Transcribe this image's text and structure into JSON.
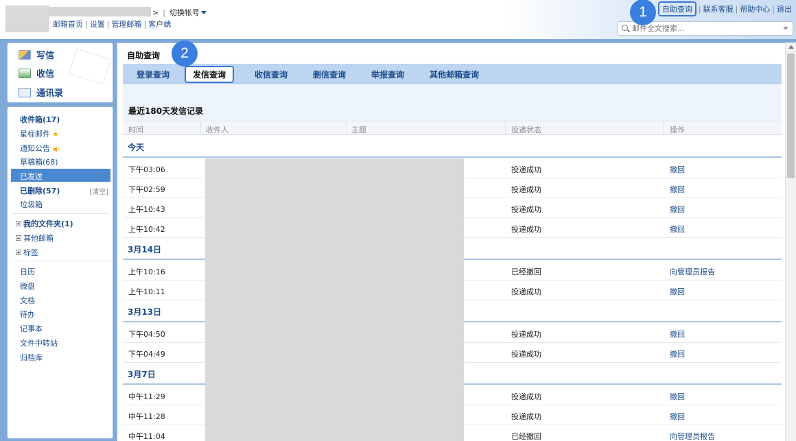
{
  "header": {
    "switch_account": "切换帐号",
    "nav": [
      "邮箱首页",
      "设置",
      "管理邮箱",
      "客户端"
    ],
    "sep_gt": ">",
    "sep_bar": "|",
    "toplinks": [
      "自助查询",
      "联系客服",
      "帮助中心",
      "退出"
    ],
    "search_placeholder": "邮件全文搜索..."
  },
  "badges": {
    "one": "1",
    "two": "2"
  },
  "sidebar": {
    "quick": [
      "写信",
      "收信",
      "通讯录"
    ],
    "folders": {
      "inbox": "收件箱(17)",
      "starred": "星标邮件",
      "notices": "通知公告",
      "drafts": "草稿箱(68)",
      "sent": "已发送",
      "deleted": "已删除(57)",
      "clean": "[清空]",
      "spam": "垃圾箱",
      "my_folders": "我的文件夹(1)",
      "other_mailboxes": "其他邮箱",
      "tags": "标签",
      "calendar": "日历",
      "drive": "微盘",
      "docs": "文档",
      "todo": "待办",
      "notes": "记事本",
      "transfer": "文件中转站",
      "archive": "归档库"
    }
  },
  "main": {
    "title": "自助查询",
    "tabs": [
      "登录查询",
      "发信查询",
      "收信查询",
      "删信查询",
      "举报查询",
      "其他邮箱查询"
    ],
    "active_tab": "发信查询",
    "subtitle": "最近180天发信记录",
    "columns": [
      "时间",
      "收件人",
      "主题",
      "投递状态",
      "操作"
    ],
    "groups": [
      {
        "label": "今天",
        "rows": [
          {
            "time": "下午03:06",
            "status": "投递成功",
            "action": "撤回"
          },
          {
            "time": "下午02:59",
            "status": "投递成功",
            "action": "撤回"
          },
          {
            "time": "上午10:43",
            "status": "投递成功",
            "action": "撤回"
          },
          {
            "time": "上午10:42",
            "status": "投递成功",
            "action": "撤回"
          }
        ]
      },
      {
        "label": "3月14日",
        "rows": [
          {
            "time": "上午10:16",
            "status": "已经撤回",
            "action": "向管理员报告"
          },
          {
            "time": "上午10:11",
            "status": "投递成功",
            "action": "撤回"
          }
        ]
      },
      {
        "label": "3月13日",
        "rows": [
          {
            "time": "下午04:50",
            "status": "投递成功",
            "action": "撤回"
          },
          {
            "time": "下午04:49",
            "status": "投递成功",
            "action": "撤回"
          }
        ]
      },
      {
        "label": "3月7日",
        "rows": [
          {
            "time": "中午11:29",
            "status": "投递成功",
            "action": "撤回"
          },
          {
            "time": "中午11:28",
            "status": "投递成功",
            "action": "撤回"
          },
          {
            "time": "中午11:04",
            "status": "已经撤回",
            "action": "向管理员报告"
          }
        ]
      }
    ]
  },
  "colors": {
    "accent": "#1d4d8c",
    "frame": "#7fa9d8",
    "tab_bar": "#bdd5f0",
    "highlight": "#3b78d8",
    "selected": "#4b88cf"
  }
}
